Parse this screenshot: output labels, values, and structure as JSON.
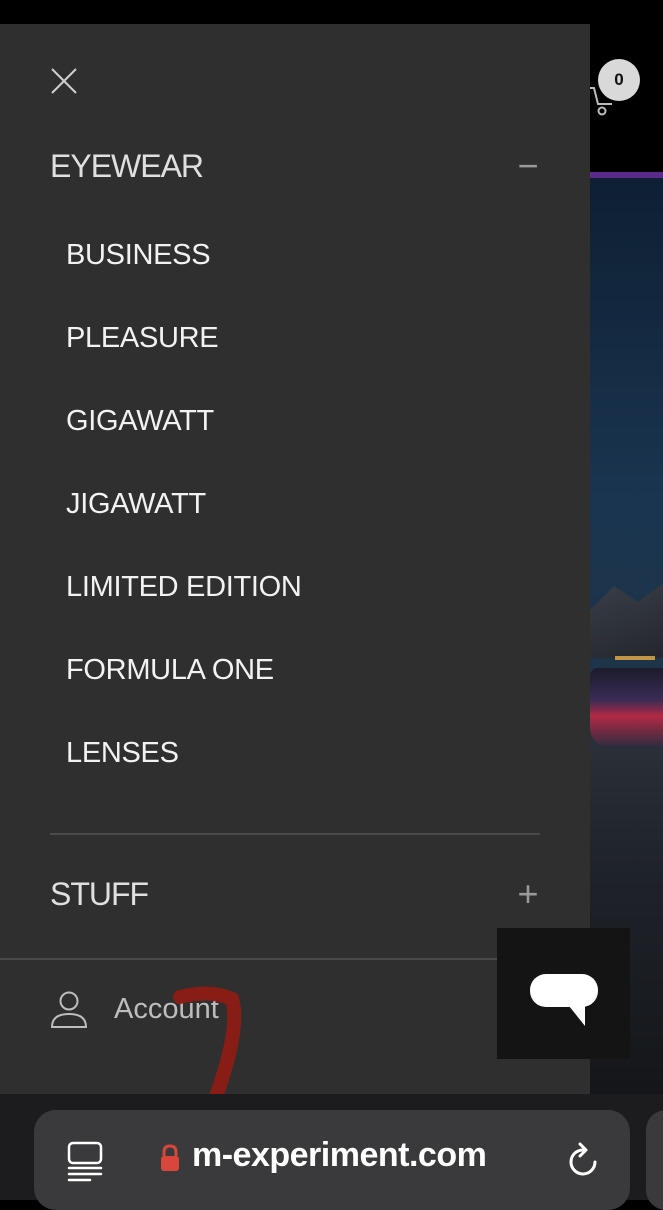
{
  "header": {
    "cart_count": "0"
  },
  "drawer": {
    "sections": [
      {
        "title": "EYEWEAR",
        "toggle": "−",
        "items": [
          "BUSINESS",
          "PLEASURE",
          "GIGAWATT",
          "JIGAWATT",
          "LIMITED EDITION",
          "FORMULA ONE",
          "LENSES"
        ]
      },
      {
        "title": "STUFF",
        "toggle": "+"
      }
    ],
    "account_label": "Account"
  },
  "browser": {
    "url": "m-experiment.com"
  },
  "icons": {
    "close": "close-icon",
    "cart": "cart-icon",
    "account": "person-icon",
    "chat": "chat-icon",
    "tabs": "tabs-icon",
    "lock": "lock-icon",
    "reload": "reload-icon"
  },
  "colors": {
    "drawer_bg": "#2f2f2f",
    "lock": "#d9473a",
    "scribble": "#8f1c14"
  }
}
